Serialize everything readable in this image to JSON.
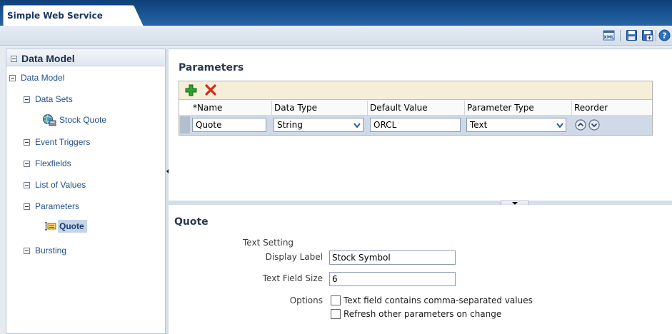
{
  "window": {
    "tab_title": "Simple Web Service",
    "toolbar_icons": [
      "xml-icon",
      "save-icon",
      "save-as-icon",
      "help-icon"
    ]
  },
  "sidebar": {
    "header": "Data Model",
    "items": [
      {
        "label": "Data Model"
      },
      {
        "label": "Data Sets"
      },
      {
        "label": "Stock Quote"
      },
      {
        "label": "Event Triggers"
      },
      {
        "label": "Flexfields"
      },
      {
        "label": "List of Values"
      },
      {
        "label": "Parameters"
      },
      {
        "label": "Quote"
      },
      {
        "label": "Bursting"
      }
    ]
  },
  "parameters": {
    "title": "Parameters",
    "columns": [
      "*Name",
      "Data Type",
      "Default Value",
      "Parameter Type",
      "Reorder"
    ],
    "rows": [
      {
        "name": "Quote",
        "data_type": "String",
        "default_value": "ORCL",
        "parameter_type": "Text"
      }
    ]
  },
  "detail": {
    "title": "Quote",
    "section_label": "Text Setting",
    "display_label_label": "Display Label",
    "display_label_value": "Stock Symbol",
    "text_field_size_label": "Text Field Size",
    "text_field_size_value": "6",
    "options_label": "Options",
    "option_comma": "Text field contains comma-separated values",
    "option_refresh": "Refresh other parameters on change"
  },
  "colors": {
    "title_bar": "#1b5796",
    "selection": "#c4d4ea",
    "add_green": "#1f9a1f",
    "delete_red": "#d62a16"
  }
}
